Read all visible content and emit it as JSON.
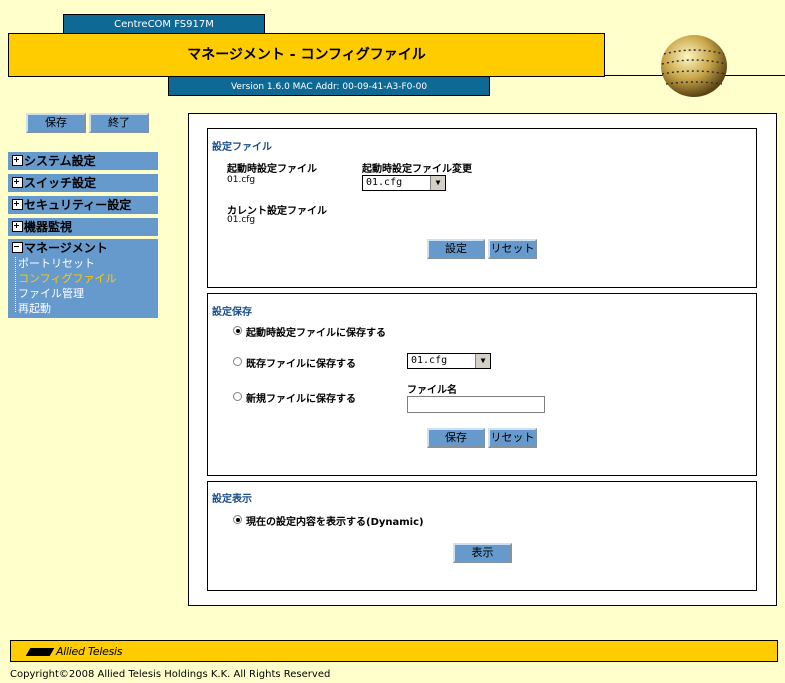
{
  "header": {
    "product": "CentreCOM FS917M",
    "title": "マネージメント - コンフィグファイル",
    "version": "Version 1.6.0 MAC Addr: 00-09-41-A3-F0-00"
  },
  "nav": {
    "save_label": "保存",
    "exit_label": "終了",
    "menu": [
      {
        "label": "システム設定"
      },
      {
        "label": "スイッチ設定"
      },
      {
        "label": "セキュリティー設定"
      },
      {
        "label": "機器監視"
      }
    ],
    "management": {
      "label": "マネージメント",
      "items": [
        {
          "label": "ポートリセット"
        },
        {
          "label": "コンフィグファイル"
        },
        {
          "label": "ファイル管理"
        },
        {
          "label": "再起動"
        }
      ]
    }
  },
  "config_file": {
    "title": "設定ファイル",
    "startup_label": "起動時設定ファイル",
    "startup_value": "01.cfg",
    "startup_change_label": "起動時設定ファイル変更",
    "startup_change_selected": "01.cfg",
    "current_label": "カレント設定ファイル",
    "current_value": "01.cfg",
    "set_button": "設定",
    "reset_button": "リセット"
  },
  "save_config": {
    "title": "設定保存",
    "option_startup": "起動時設定ファイルに保存する",
    "option_existing": "既存ファイルに保存する",
    "existing_selected": "01.cfg",
    "option_new": "新規ファイルに保存する",
    "filename_label": "ファイル名",
    "filename_value": "",
    "save_button": "保存",
    "reset_button": "リセット"
  },
  "display_config": {
    "title": "設定表示",
    "option_current": "現在の設定内容を表示する(Dynamic)",
    "show_button": "表示"
  },
  "footer": {
    "logo": "Allied Telesis",
    "copyright": "Copyright©2008 Allied Telesis Holdings K.K. All Rights Reserved"
  },
  "colors": {
    "background": "#ffffcc",
    "accent_yellow": "#ffcc00",
    "accent_blue": "#0e6a94",
    "menu_blue": "#6699cc",
    "active_link": "#ffcc00"
  }
}
